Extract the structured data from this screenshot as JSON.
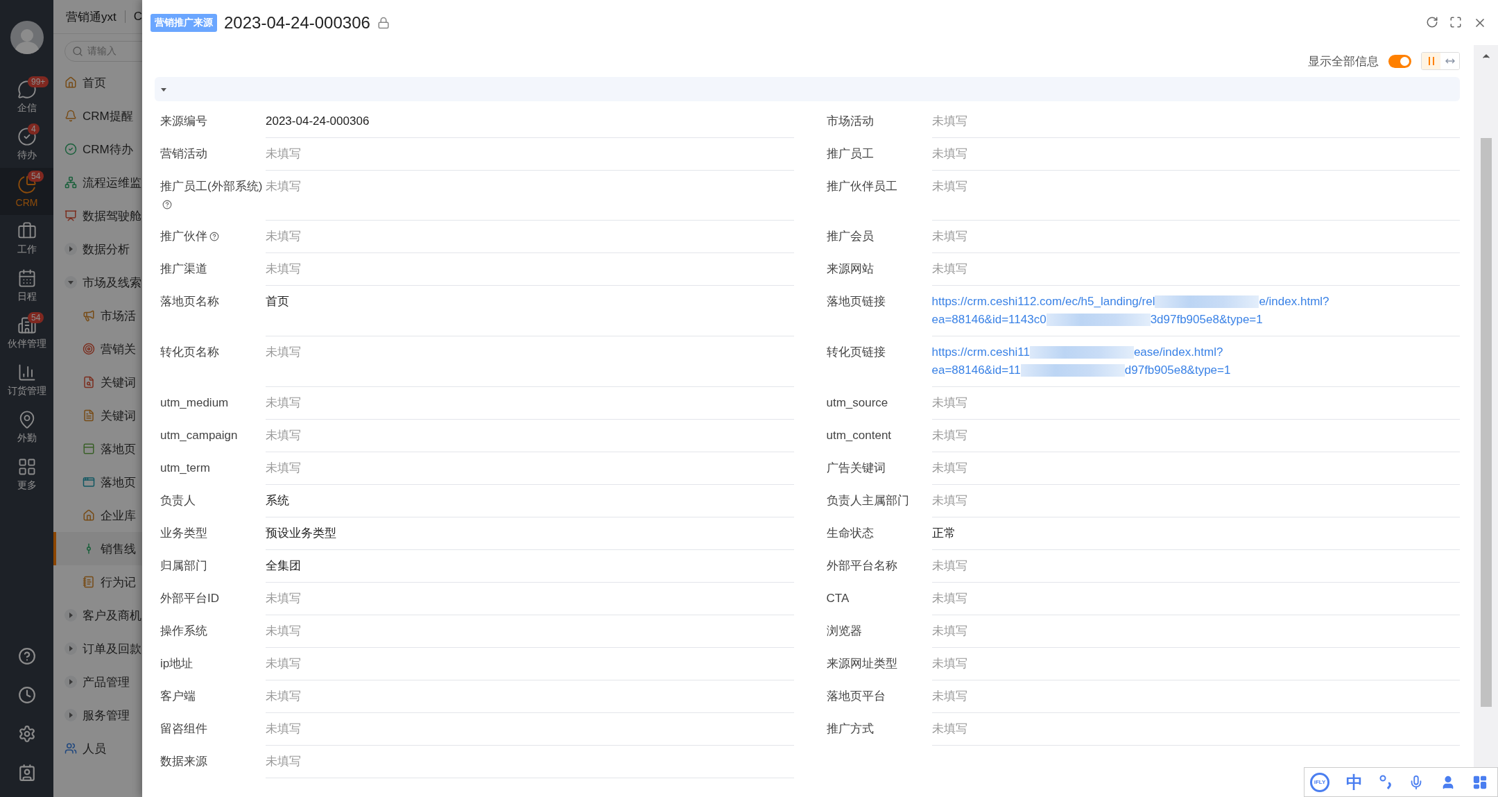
{
  "rail": {
    "items": [
      {
        "label": "企信",
        "kind": "chat",
        "badge": "99+",
        "selected": false
      },
      {
        "label": "待办",
        "kind": "todo",
        "badge": "4",
        "selected": false
      },
      {
        "label": "CRM",
        "kind": "crm",
        "badge": "54",
        "selected": true
      },
      {
        "label": "工作",
        "kind": "work",
        "selected": false
      },
      {
        "label": "日程",
        "kind": "calendar",
        "selected": false
      },
      {
        "label": "伙伴管理",
        "kind": "partner",
        "badge": "54",
        "selected": false
      },
      {
        "label": "订货管理",
        "kind": "order",
        "selected": false
      },
      {
        "label": "外勤",
        "kind": "location",
        "selected": false
      },
      {
        "label": "更多",
        "kind": "more",
        "selected": false
      }
    ]
  },
  "app_header": {
    "title": "营销通yxt",
    "cut_text": "C"
  },
  "search": {
    "placeholder": "请输入"
  },
  "nav": [
    {
      "label": "首页",
      "kind": "home",
      "selected": false
    },
    {
      "label": "CRM提醒",
      "kind": "bell",
      "selected": false
    },
    {
      "label": "CRM待办",
      "kind": "check",
      "selected": false
    },
    {
      "label": "流程运维监",
      "kind": "flow",
      "selected": false
    },
    {
      "label": "数据驾驶舱",
      "kind": "screen",
      "selected": false
    },
    {
      "label": "数据分析",
      "kind": "group",
      "expanded": false
    },
    {
      "label": "市场及线索",
      "kind": "group",
      "expanded": true,
      "children": [
        {
          "label": "市场活",
          "kind": "megaphone",
          "selected": false
        },
        {
          "label": "营销关",
          "kind": "target",
          "selected": false
        },
        {
          "label": "关键词",
          "kind": "keyword",
          "selected": false
        },
        {
          "label": "关键词",
          "kind": "keyword2",
          "selected": false
        },
        {
          "label": "落地页",
          "kind": "page",
          "selected": false
        },
        {
          "label": "落地页",
          "kind": "page2",
          "selected": false
        },
        {
          "label": "企业库",
          "kind": "company",
          "selected": false
        },
        {
          "label": "销售线",
          "kind": "leads",
          "selected": true
        },
        {
          "label": "行为记",
          "kind": "record",
          "selected": false
        }
      ]
    },
    {
      "label": "客户及商机",
      "kind": "group",
      "expanded": false
    },
    {
      "label": "订单及回款",
      "kind": "group",
      "expanded": false
    },
    {
      "label": "产品管理",
      "kind": "group",
      "expanded": false
    },
    {
      "label": "服务管理",
      "kind": "group",
      "expanded": false
    },
    {
      "label": "人员",
      "kind": "people",
      "selected": false
    }
  ],
  "record": {
    "tag": "营销推广来源",
    "title": "2023-04-24-000306"
  },
  "show_all": {
    "label": "显示全部信息",
    "on": true
  },
  "layout_toggle": [
    {
      "kind": "columns",
      "selected": true
    },
    {
      "kind": "wide",
      "selected": false
    }
  ],
  "section": {
    "expanded": true
  },
  "fields": [
    [
      {
        "label": "来源编号",
        "value": "2023-04-24-000306",
        "empty": false
      },
      {
        "label": "市场活动",
        "value": "未填写",
        "empty": true
      }
    ],
    [
      {
        "label": "营销活动",
        "value": "未填写",
        "empty": true
      },
      {
        "label": "推广员工",
        "value": "未填写",
        "empty": true
      }
    ],
    [
      {
        "label": "推广员工(外部系统)",
        "help": true,
        "value": "未填写",
        "empty": true
      },
      {
        "label": "推广伙伴员工",
        "value": "未填写",
        "empty": true
      }
    ],
    [
      {
        "label": "推广伙伴",
        "help": true,
        "value": "未填写",
        "empty": true
      },
      {
        "label": "推广会员",
        "value": "未填写",
        "empty": true
      }
    ],
    [
      {
        "label": "推广渠道",
        "value": "未填写",
        "empty": true
      },
      {
        "label": "来源网站",
        "value": "未填写",
        "empty": true
      }
    ],
    [
      {
        "label": "落地页名称",
        "value": "首页",
        "empty": false
      },
      {
        "label": "落地页链接",
        "kind": "link",
        "lines": [
          {
            "before": "https://crm.ceshi112.com/ec/h5_landing/rel",
            "after": "e/index.html?"
          },
          {
            "before": "ea=88146&id=1143c0",
            "after": "3d97fb905e8&type=1"
          }
        ]
      }
    ],
    [
      {
        "label": "转化页名称",
        "value": "未填写",
        "empty": true
      },
      {
        "label": "转化页链接",
        "kind": "link",
        "lines": [
          {
            "before": "https://crm.ceshi11",
            "after": "ease/index.html?"
          },
          {
            "before": "ea=88146&id=11",
            "after": "d97fb905e8&type=1"
          }
        ]
      }
    ],
    [
      {
        "label": "utm_medium",
        "value": "未填写",
        "empty": true
      },
      {
        "label": "utm_source",
        "value": "未填写",
        "empty": true
      }
    ],
    [
      {
        "label": "utm_campaign",
        "value": "未填写",
        "empty": true
      },
      {
        "label": "utm_content",
        "value": "未填写",
        "empty": true
      }
    ],
    [
      {
        "label": "utm_term",
        "value": "未填写",
        "empty": true
      },
      {
        "label": "广告关键词",
        "value": "未填写",
        "empty": true
      }
    ],
    [
      {
        "label": "负责人",
        "value": "系统",
        "empty": false
      },
      {
        "label": "负责人主属部门",
        "value": "未填写",
        "empty": true
      }
    ],
    [
      {
        "label": "业务类型",
        "value": "预设业务类型",
        "empty": false
      },
      {
        "label": "生命状态",
        "value": "正常",
        "empty": false
      }
    ],
    [
      {
        "label": "归属部门",
        "value": "全集团",
        "empty": false
      },
      {
        "label": "外部平台名称",
        "value": "未填写",
        "empty": true
      }
    ],
    [
      {
        "label": "外部平台ID",
        "value": "未填写",
        "empty": true
      },
      {
        "label": "CTA",
        "value": "未填写",
        "empty": true
      }
    ],
    [
      {
        "label": "操作系统",
        "value": "未填写",
        "empty": true
      },
      {
        "label": "浏览器",
        "value": "未填写",
        "empty": true
      }
    ],
    [
      {
        "label": "ip地址",
        "value": "未填写",
        "empty": true
      },
      {
        "label": "来源网址类型",
        "value": "未填写",
        "empty": true
      }
    ],
    [
      {
        "label": "客户端",
        "value": "未填写",
        "empty": true
      },
      {
        "label": "落地页平台",
        "value": "未填写",
        "empty": true
      }
    ],
    [
      {
        "label": "留咨组件",
        "value": "未填写",
        "empty": true
      },
      {
        "label": "推广方式",
        "value": "未填写",
        "empty": true
      }
    ],
    [
      {
        "label": "数据来源",
        "value": "未填写",
        "empty": true
      }
    ]
  ],
  "ime_bar": {
    "logo": "iFLY",
    "mode": "中"
  }
}
